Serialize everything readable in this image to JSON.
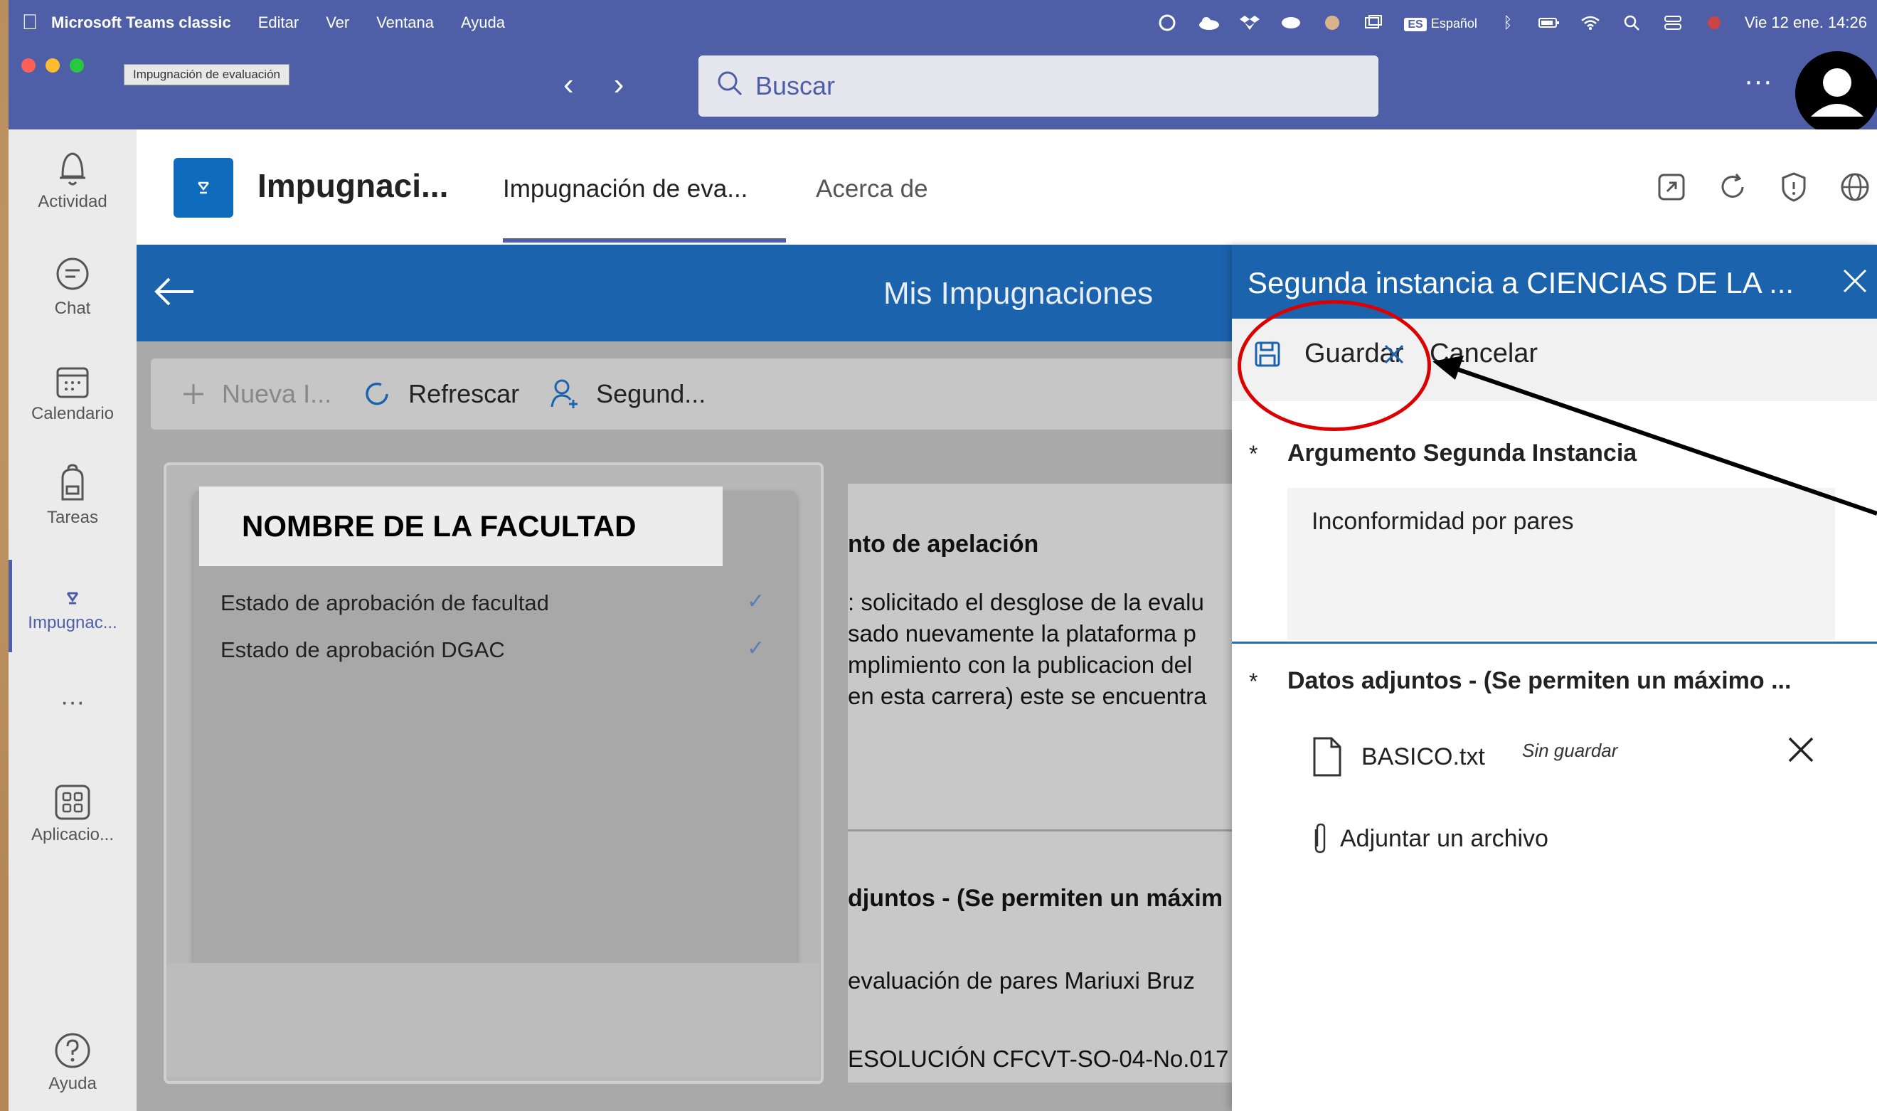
{
  "menubar": {
    "app": "Microsoft Teams classic",
    "items": [
      "Editar",
      "Ver",
      "Ventana",
      "Ayuda"
    ],
    "keyboard_badge": "ES",
    "keyboard_lang": "Español",
    "datetime": "Vie 12 ene.  14:26"
  },
  "titlebar": {
    "tooltip": "Impugnación de evaluación",
    "search_placeholder": "Buscar",
    "more": "···"
  },
  "rail": {
    "items": [
      {
        "label": "Actividad",
        "icon": "bell-icon"
      },
      {
        "label": "Chat",
        "icon": "chat-icon"
      },
      {
        "label": "Calendario",
        "icon": "calendar-icon"
      },
      {
        "label": "Tareas",
        "icon": "backpack-icon"
      },
      {
        "label": "Impugnac...",
        "icon": "app-icon"
      },
      {
        "label": "···",
        "icon": "more-icon"
      },
      {
        "label": "Aplicacio...",
        "icon": "apps-icon"
      },
      {
        "label": "Ayuda",
        "icon": "help-icon"
      }
    ]
  },
  "app_header": {
    "name": "Impugnaci...",
    "tabs": [
      "Impugnación de eva...",
      "Acerca de"
    ]
  },
  "main": {
    "title": "Mis Impugnaciones",
    "commands": [
      "Nueva I...",
      "Refrescar",
      "Segund..."
    ],
    "facultad": "NOMBRE DE LA FACULTAD",
    "status_rows": [
      "Estado de aprobación de facultad",
      "Estado de aprobación DGAC"
    ],
    "check": "✓",
    "detail_lines": [
      "nto de apelación",
      ": solicitado el desglose de la evalu",
      "sado nuevamente la plataforma p",
      "mplimiento con la publicacion del",
      "en esta carrera) este se encuentra",
      "djuntos - (Se permiten un máxim",
      "evaluación de pares Mariuxi Bruz",
      "ESOLUCIÓN CFCVT-SO-04-No.017"
    ]
  },
  "panel": {
    "title": "Segunda instancia a CIENCIAS DE LA ...",
    "save": "Guardar",
    "cancel": "Cancelar",
    "required_mark": "*",
    "field1_label": "Argumento Segunda Instancia",
    "field1_value": "Inconformidad por pares",
    "field2_label": "Datos adjuntos - (Se permiten un máximo ...",
    "file_name": "BASICO.txt",
    "file_note": "Sin guardar",
    "attach": "Adjuntar un archivo"
  },
  "colors": {
    "teams_purple": "#4e5fa8",
    "powerapps_blue": "#1c63ad",
    "annotation_red": "#dd0000"
  }
}
